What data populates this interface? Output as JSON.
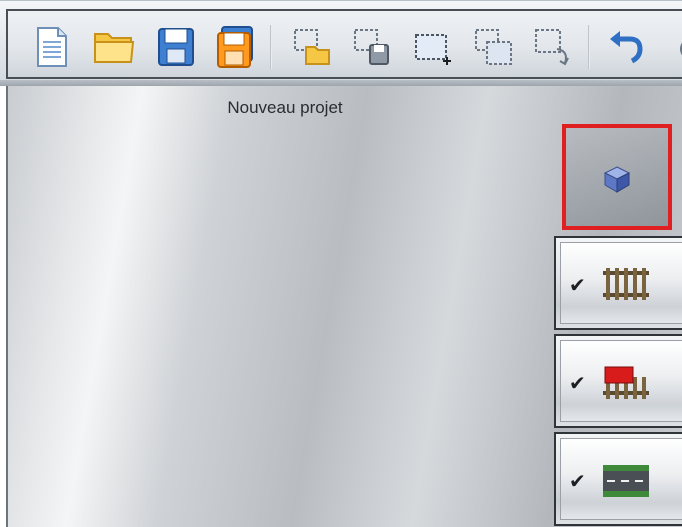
{
  "toolbar": {
    "buttons": [
      {
        "name": "new-document-icon"
      },
      {
        "name": "open-folder-icon"
      },
      {
        "name": "save-icon"
      },
      {
        "name": "save-as-icon"
      },
      {
        "name": "open-selection-icon"
      },
      {
        "name": "save-selection-icon"
      },
      {
        "name": "add-selection-icon"
      },
      {
        "name": "copy-selection-icon"
      },
      {
        "name": "rotate-selection-icon"
      },
      {
        "name": "undo-icon"
      }
    ]
  },
  "project": {
    "title": "Nouveau projet"
  },
  "side_panel": {
    "cube_highlight_color": "#e02020",
    "layers": [
      {
        "name": "layer-track",
        "checked": true,
        "check_mark": "✔"
      },
      {
        "name": "layer-wagon",
        "checked": true,
        "check_mark": "✔"
      },
      {
        "name": "layer-road",
        "checked": true,
        "check_mark": "✔"
      }
    ]
  }
}
